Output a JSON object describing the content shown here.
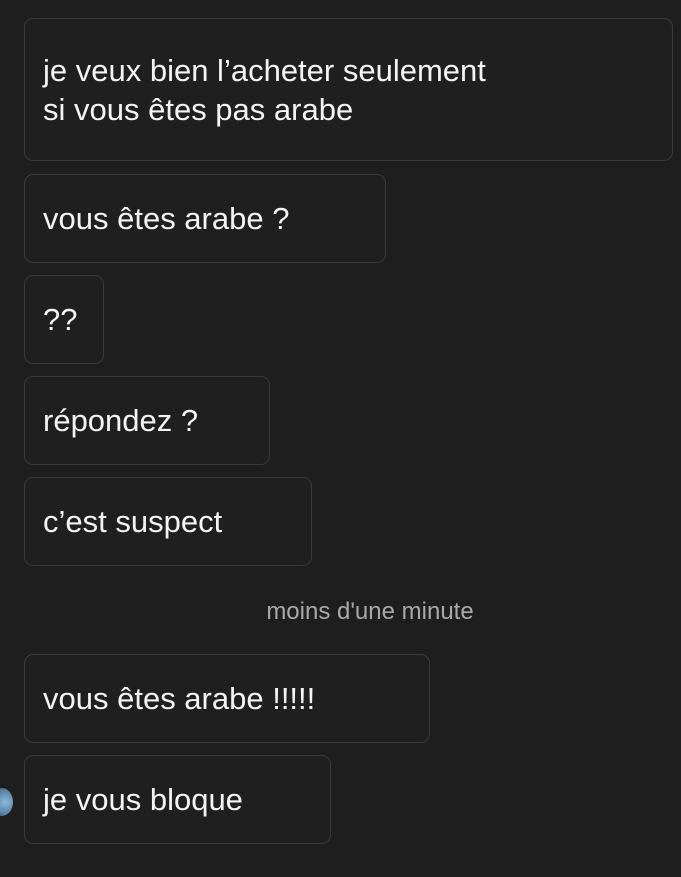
{
  "conversation": {
    "messages": [
      {
        "lines": [
          "je veux bien l’acheter seulement",
          "si vous êtes pas arabe"
        ]
      },
      {
        "text": "vous êtes arabe ?"
      },
      {
        "text": "??"
      },
      {
        "text": "répondez ?"
      },
      {
        "text": "c’est suspect"
      },
      {
        "text": "vous êtes arabe !!!!!"
      },
      {
        "text": "je vous bloque"
      }
    ],
    "timestamp": "moins d'une minute"
  },
  "colors": {
    "background": "#1e1e1f",
    "bubble_border": "#3a3a3c",
    "text": "#f4f4f4",
    "timestamp": "#a9a9ab"
  },
  "icons": {
    "avatar": "contact-avatar"
  }
}
